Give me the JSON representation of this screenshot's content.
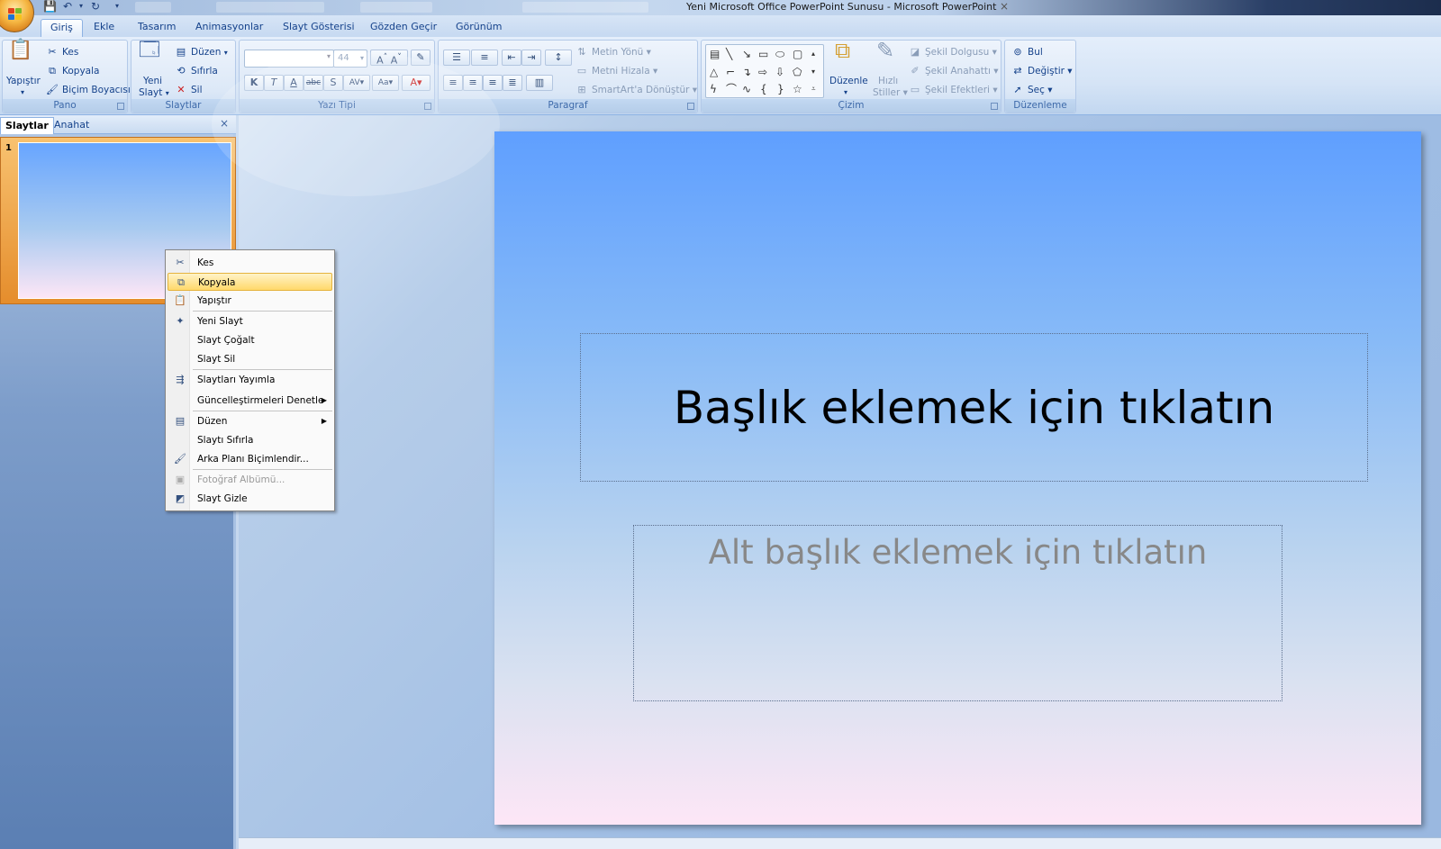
{
  "window": {
    "title": "Yeni Microsoft Office PowerPoint Sunusu - Microsoft PowerPoint"
  },
  "tabs": [
    "Giriş",
    "Ekle",
    "Tasarım",
    "Animasyonlar",
    "Slayt Gösterisi",
    "Gözden Geçir",
    "Görünüm"
  ],
  "ribbon": {
    "pano": {
      "label": "Pano",
      "paste": "Yapıştır",
      "cut": "Kes",
      "copy": "Kopyala",
      "format_painter": "Biçim Boyacısı"
    },
    "slaytlar": {
      "label": "Slaytlar",
      "new_slide_1": "Yeni",
      "new_slide_2": "Slayt",
      "layout": "Düzen",
      "reset": "Sıfırla",
      "delete": "Sil"
    },
    "yazi_tipi": {
      "label": "Yazı Tipi",
      "font_size": "44",
      "font_name": ""
    },
    "paragraf": {
      "label": "Paragraf",
      "text_direction": "Metin Yönü",
      "align_text": "Metni Hizala",
      "smartart": "SmartArt'a Dönüştür"
    },
    "cizim": {
      "label": "Çizim",
      "arrange": "Düzenle",
      "quick_styles_1": "Hızlı",
      "quick_styles_2": "Stiller",
      "shape_fill": "Şekil Dolgusu",
      "shape_outline": "Şekil Anahattı",
      "shape_effects": "Şekil Efektleri"
    },
    "duzenleme": {
      "label": "Düzenleme",
      "find": "Bul",
      "replace": "Değiştir",
      "select": "Seç"
    }
  },
  "panel": {
    "tab_slides": "Slaytlar",
    "tab_outline": "Anahat",
    "close": "×",
    "slide_number": "1"
  },
  "context_menu": {
    "items": [
      "Kes",
      "Kopyala",
      "Yapıştır",
      "Yeni Slayt",
      "Slayt Çoğalt",
      "Slayt Sil",
      "Slaytları Yayımla",
      "Güncelleştirmeleri Denetle",
      "Düzen",
      "Slaytı Sıfırla",
      "Arka Planı Biçimlendir...",
      "Fotoğraf Albümü...",
      "Slayt Gizle"
    ],
    "highlighted": "Kopyala",
    "disabled": "Fotoğraf Albümü..."
  },
  "slide": {
    "title_placeholder": "Başlık eklemek için tıklatın",
    "subtitle_placeholder": "Alt başlık eklemek için tıklatın"
  }
}
